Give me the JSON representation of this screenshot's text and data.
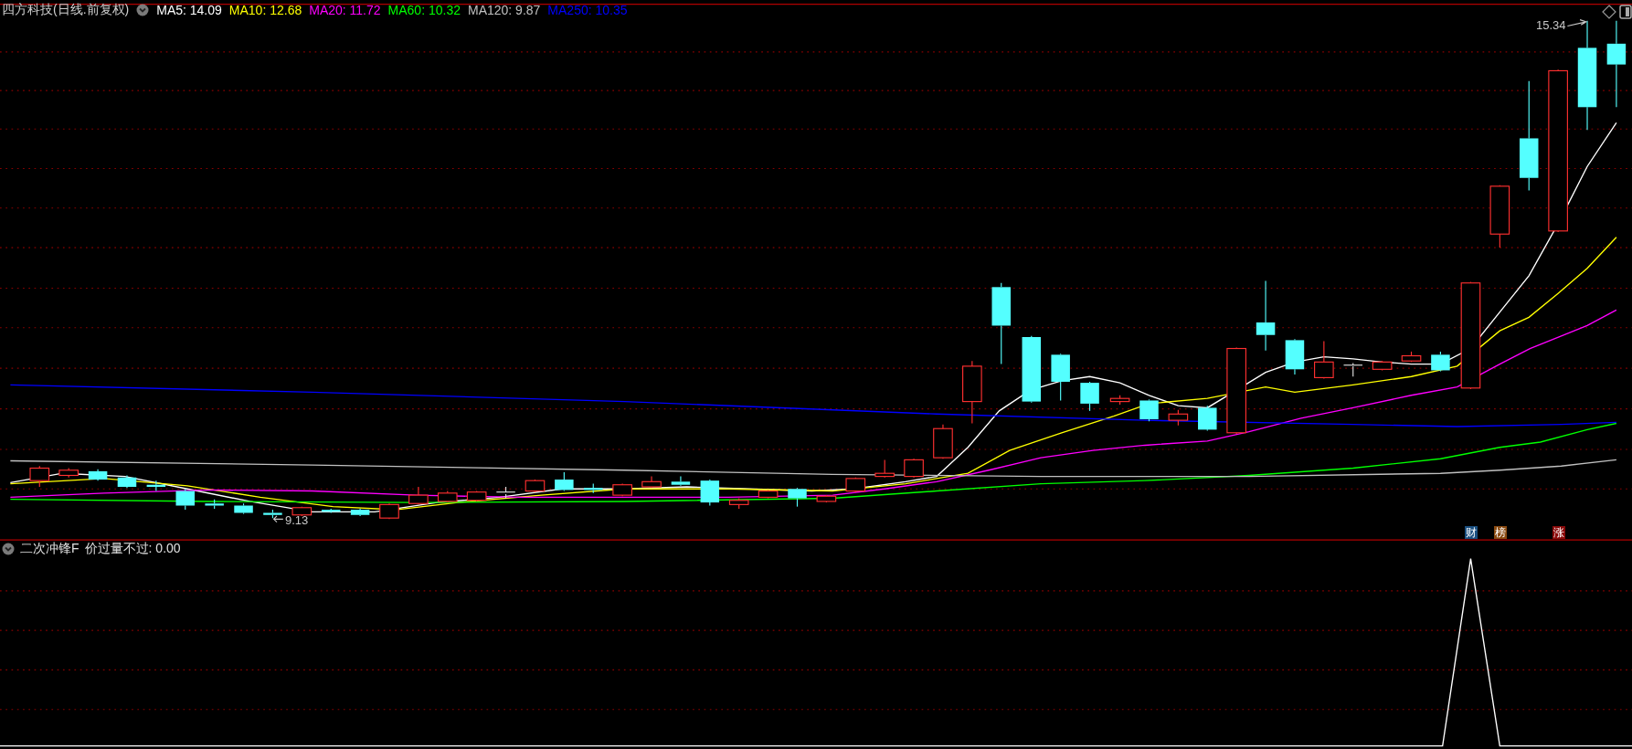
{
  "title": "四方科技(日线.前复权)",
  "moving_averages": [
    {
      "text": "MA5: 14.09",
      "color": "#ffffff"
    },
    {
      "text": "MA10: 12.68",
      "color": "#ffff00"
    },
    {
      "text": "MA20: 11.72",
      "color": "#ff00ff"
    },
    {
      "text": "MA60: 10.32",
      "color": "#00ff00"
    },
    {
      "text": "MA120: 9.87",
      "color": "#c0c0c0"
    },
    {
      "text": "MA250: 10.35",
      "color": "#0000ff"
    }
  ],
  "annotations": [
    {
      "kind": "high",
      "text": "15.34"
    },
    {
      "kind": "low",
      "text": "9.13"
    }
  ],
  "event_badges": [
    {
      "text": "财",
      "color": "#1a4f80"
    },
    {
      "text": "榜",
      "color": "#8a4a10"
    },
    {
      "text": "涨",
      "color": "#8a0a0a"
    }
  ],
  "indicator": {
    "name": "二次冲锋F",
    "reading": "价过量不过: 0.00"
  }
}
